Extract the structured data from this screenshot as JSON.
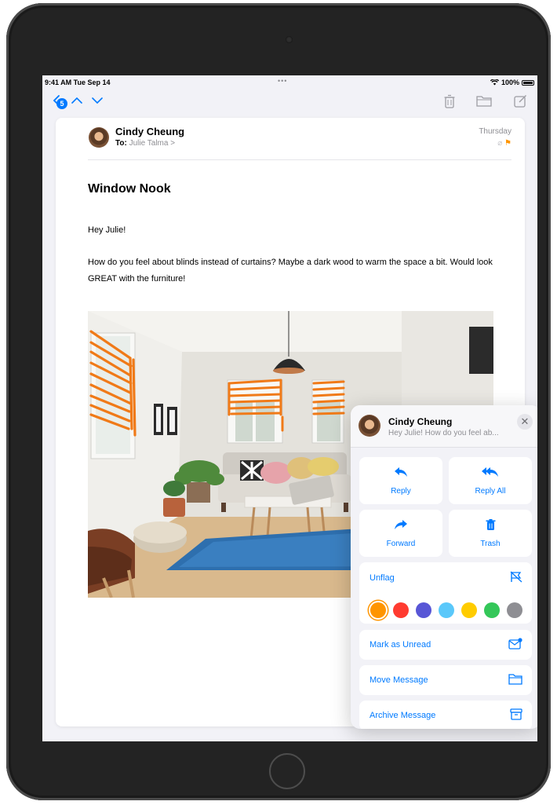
{
  "status_bar": {
    "time": "9:41 AM  Tue Sep 14",
    "dots": "•••",
    "battery": "100%"
  },
  "toolbar": {
    "back_icon": "chevron-left-icon",
    "unread_count": "5",
    "prev_icon": "chevron-up-icon",
    "next_icon": "chevron-down-icon",
    "trash_icon": "trash-icon",
    "folder_icon": "folder-icon",
    "compose_icon": "compose-icon"
  },
  "email": {
    "sender": "Cindy Cheung",
    "to_label": "To:",
    "recipient": "Julie Talma >",
    "date": "Thursday",
    "subject": "Window Nook",
    "greeting": "Hey Julie!",
    "body": "How do you feel about blinds instead of curtains? Maybe a dark wood to warm the space a bit. Would look GREAT with the furniture!"
  },
  "popover": {
    "sender": "Cindy Cheung",
    "preview": "Hey Julie! How do you feel ab...",
    "close": "✕",
    "actions": [
      {
        "label": "Reply",
        "icon": "reply-icon"
      },
      {
        "label": "Reply All",
        "icon": "reply-all-icon"
      },
      {
        "label": "Forward",
        "icon": "forward-icon"
      },
      {
        "label": "Trash",
        "icon": "trash-icon"
      }
    ],
    "unflag_label": "Unflag",
    "flag_colors": [
      "#ff9500",
      "#ff3b30",
      "#5856d6",
      "#5ac8fa",
      "#ffcc00",
      "#34c759",
      "#8e8e93"
    ],
    "selected_color": "#ff9500",
    "mark_unread": "Mark as Unread",
    "move_message": "Move Message",
    "archive_message": "Archive Message"
  },
  "accent_color": "#007aff"
}
